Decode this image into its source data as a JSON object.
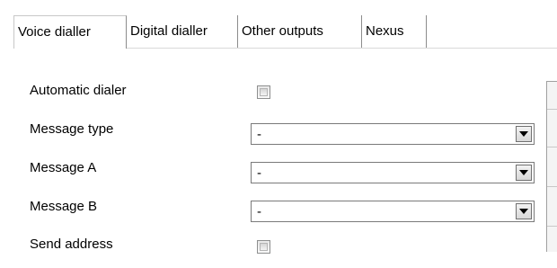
{
  "tabs": [
    {
      "label": "Voice dialler",
      "active": true
    },
    {
      "label": "Digital dialler",
      "active": false
    },
    {
      "label": "Other outputs",
      "active": false
    },
    {
      "label": "Nexus",
      "active": false
    }
  ],
  "form": {
    "automatic_dialer": {
      "label": "Automatic dialer",
      "checked": false
    },
    "message_type": {
      "label": "Message type",
      "value": "-"
    },
    "message_a": {
      "label": "Message A",
      "value": "-"
    },
    "message_b": {
      "label": "Message B",
      "value": "-"
    },
    "send_address": {
      "label": "Send address",
      "checked": false
    }
  },
  "icons": {
    "dropdown": "chevron-down-icon"
  }
}
